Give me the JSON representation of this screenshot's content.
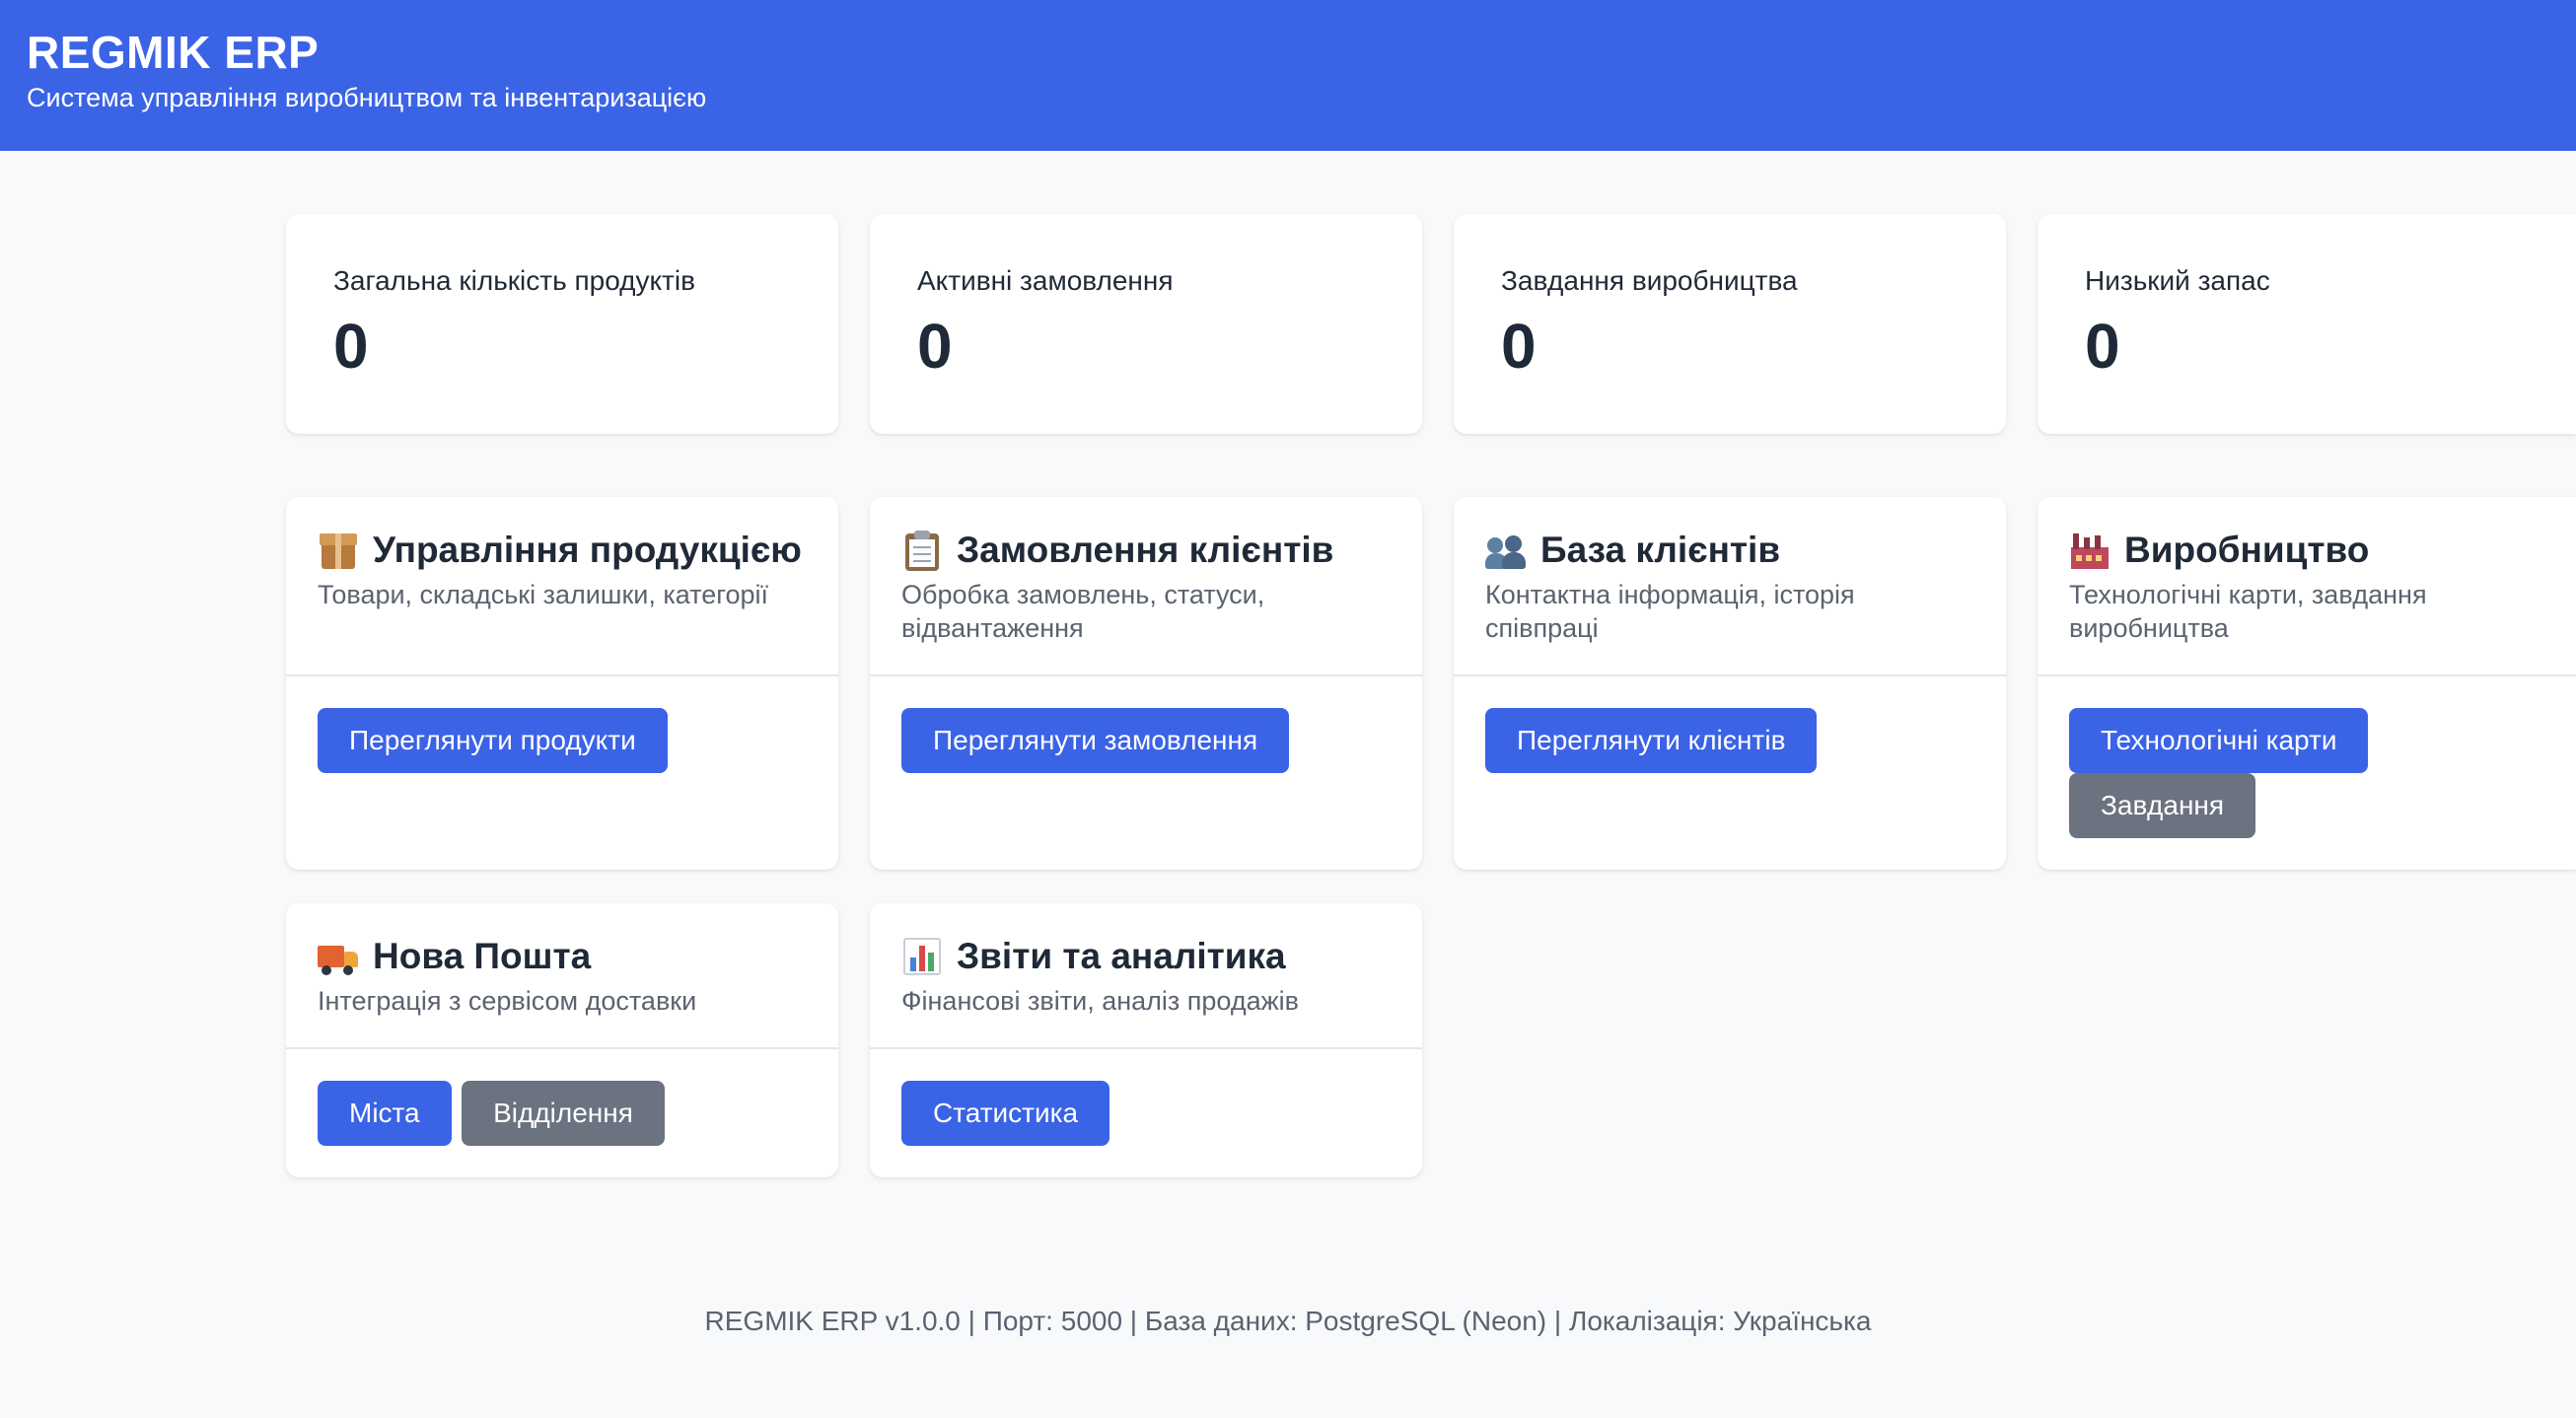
{
  "header": {
    "title": "REGMIK ERP",
    "subtitle": "Система управління виробництвом та інвентаризацією"
  },
  "stats": [
    {
      "label": "Загальна кількість продуктів",
      "value": "0"
    },
    {
      "label": "Активні замовлення",
      "value": "0"
    },
    {
      "label": "Завдання виробництва",
      "value": "0"
    },
    {
      "label": "Низький запас",
      "value": "0"
    }
  ],
  "modules": {
    "products": {
      "icon": "package-icon",
      "title": "Управління продукцією",
      "description": "Товари, складські залишки, категорії",
      "buttons": [
        "Переглянути продукти"
      ]
    },
    "orders": {
      "icon": "clipboard-icon",
      "title": "Замовлення клієнтів",
      "description": "Обробка замовлень, статуси, відвантаження",
      "buttons": [
        "Переглянути замовлення"
      ]
    },
    "clients": {
      "icon": "people-icon",
      "title": "База клієнтів",
      "description": "Контактна інформація, історія співпраці",
      "buttons": [
        "Переглянути клієнтів"
      ]
    },
    "production": {
      "icon": "factory-icon",
      "title": "Виробництво",
      "description": "Технологічні карти, завдання виробництва",
      "buttons": [
        "Технологічні карти",
        "Завдання"
      ]
    },
    "novaposhta": {
      "icon": "delivery-truck-icon",
      "title": "Нова Пошта",
      "description": "Інтеграція з сервісом доставки",
      "buttons": [
        "Міста",
        "Відділення"
      ]
    },
    "reports": {
      "icon": "bar-chart-icon",
      "title": "Звіти та аналітика",
      "description": "Фінансові звіти, аналіз продажів",
      "buttons": [
        "Статистика"
      ]
    }
  },
  "footer": {
    "text": "REGMIK ERP v1.0.0 | Порт: 5000 | База даних: PostgreSQL (Neon) | Локалізація: Українська"
  },
  "colors": {
    "primary": "#3b63e6",
    "secondary": "#6b7280",
    "background": "#f8f9fb"
  }
}
